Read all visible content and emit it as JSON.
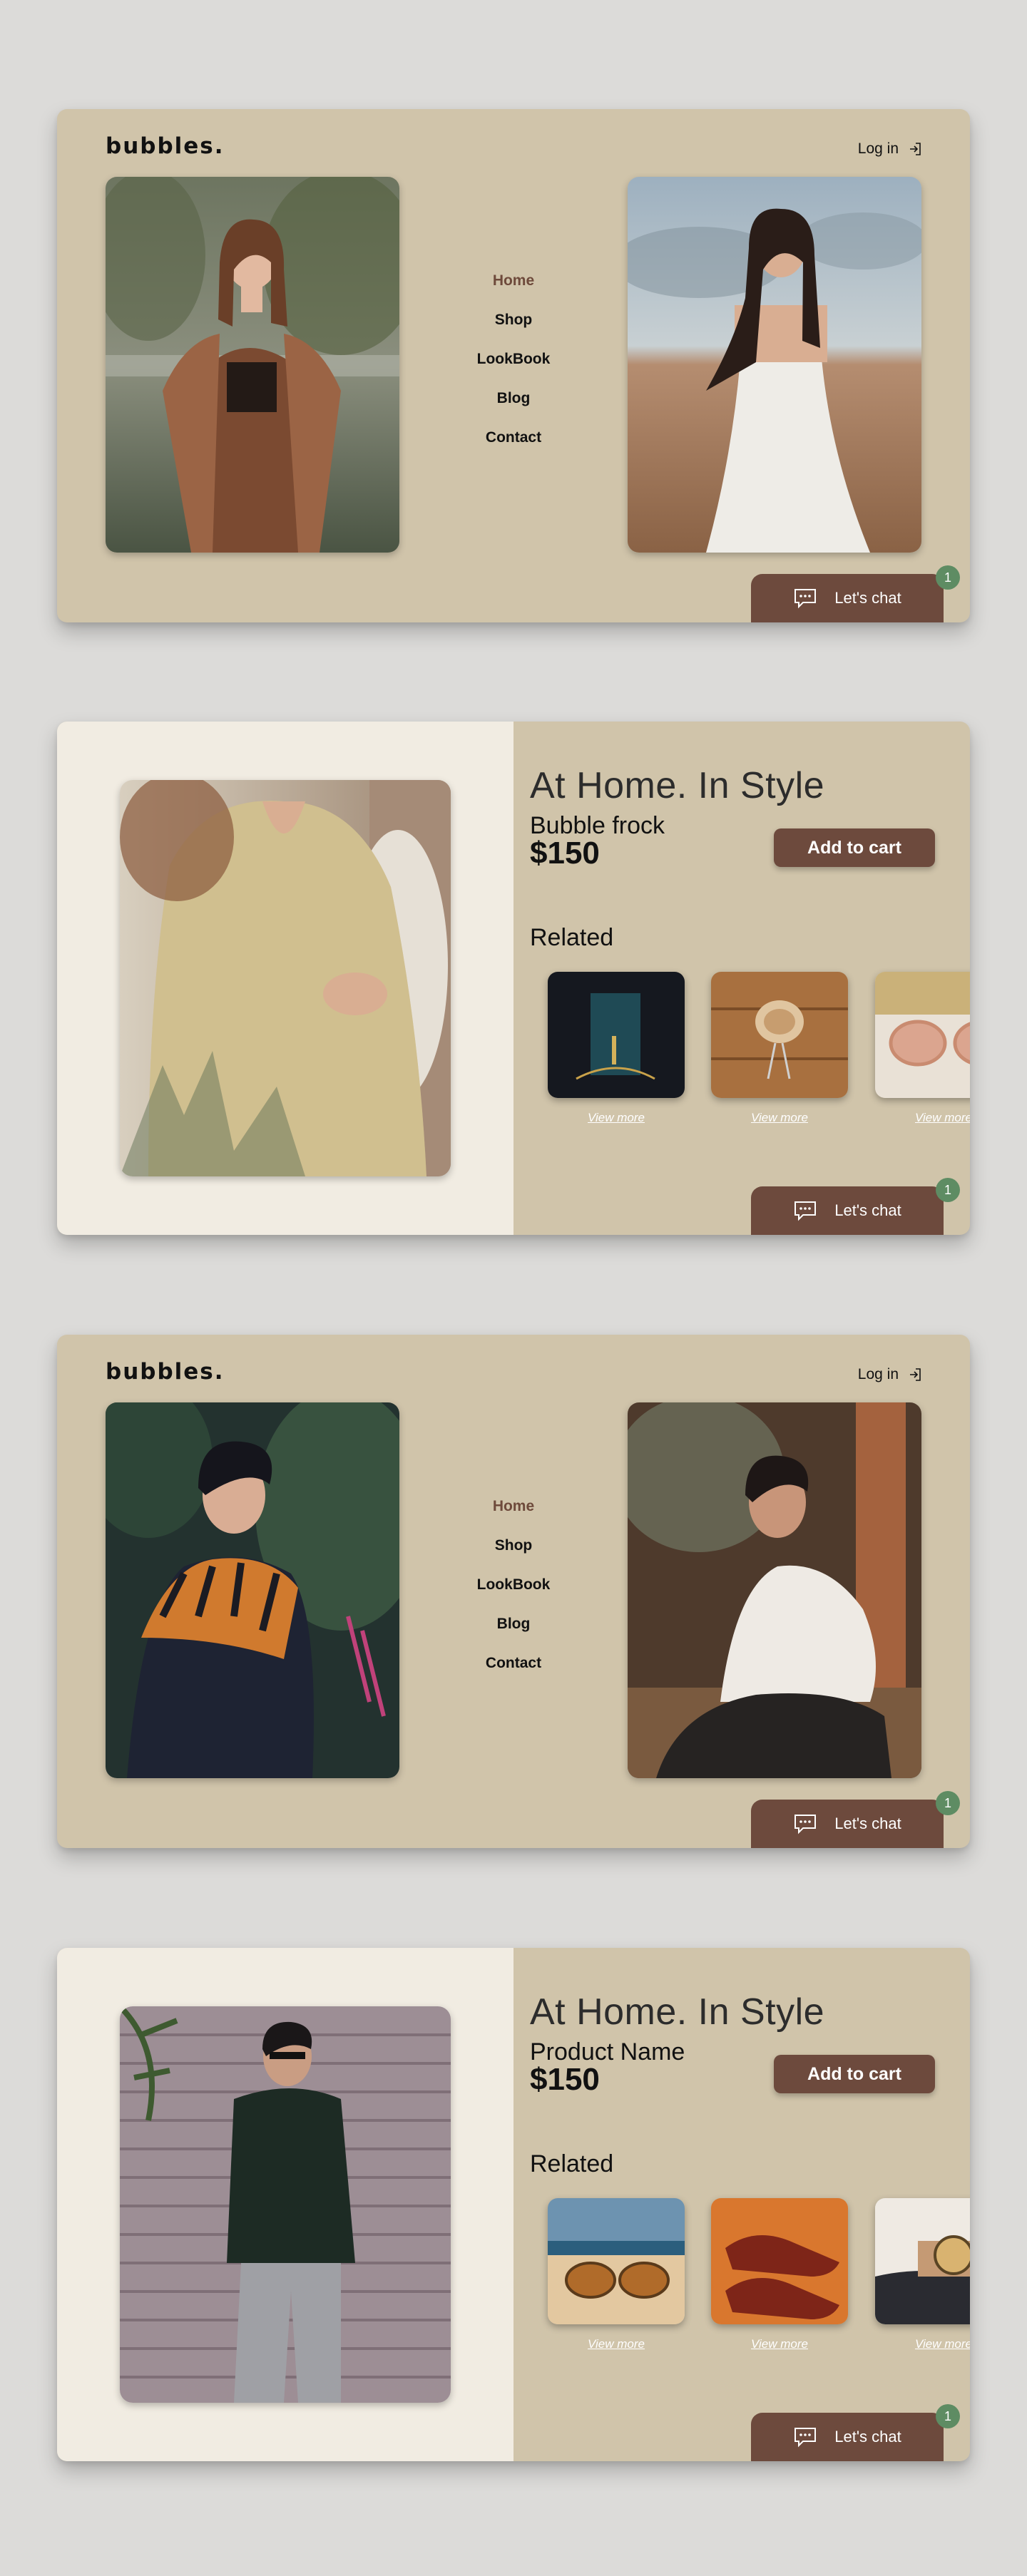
{
  "screens": [
    {
      "type": "home",
      "logo": "bubbles.",
      "login_label": "Log in",
      "menu": [
        "Home",
        "Shop",
        "LookBook",
        "Blog",
        "Contact"
      ],
      "active_menu": "Home",
      "chat_label": "Let's chat",
      "chat_badge": "1"
    },
    {
      "type": "product",
      "headline": "At Home. In Style",
      "product_name": "Bubble frock",
      "price": "$150",
      "add_to_cart_label": "Add to cart",
      "related_title": "Related",
      "related": [
        {
          "view_more": "View more"
        },
        {
          "view_more": "View more"
        },
        {
          "view_more": "View more"
        }
      ],
      "chat_label": "Let's chat",
      "chat_badge": "1"
    },
    {
      "type": "home",
      "logo": "bubbles.",
      "login_label": "Log in",
      "menu": [
        "Home",
        "Shop",
        "LookBook",
        "Blog",
        "Contact"
      ],
      "active_menu": "Home",
      "chat_label": "Let's chat",
      "chat_badge": "1"
    },
    {
      "type": "product",
      "headline": "At Home. In Style",
      "product_name": "Product Name",
      "price": "$150",
      "add_to_cart_label": "Add to cart",
      "related_title": "Related",
      "related": [
        {
          "view_more": "View more"
        },
        {
          "view_more": "View more"
        },
        {
          "view_more": "View more"
        }
      ],
      "chat_label": "Let's chat",
      "chat_badge": "1"
    }
  ],
  "colors": {
    "page_bg": "#dcdbd9",
    "card_bg": "#d0c4aa",
    "panel_light": "#f1ece2",
    "accent_brown": "#6d4a3d",
    "badge_green": "#5e8c63",
    "active_menu": "#6e4a3b"
  },
  "icons": [
    "login-icon",
    "chat-bubble-icon"
  ]
}
